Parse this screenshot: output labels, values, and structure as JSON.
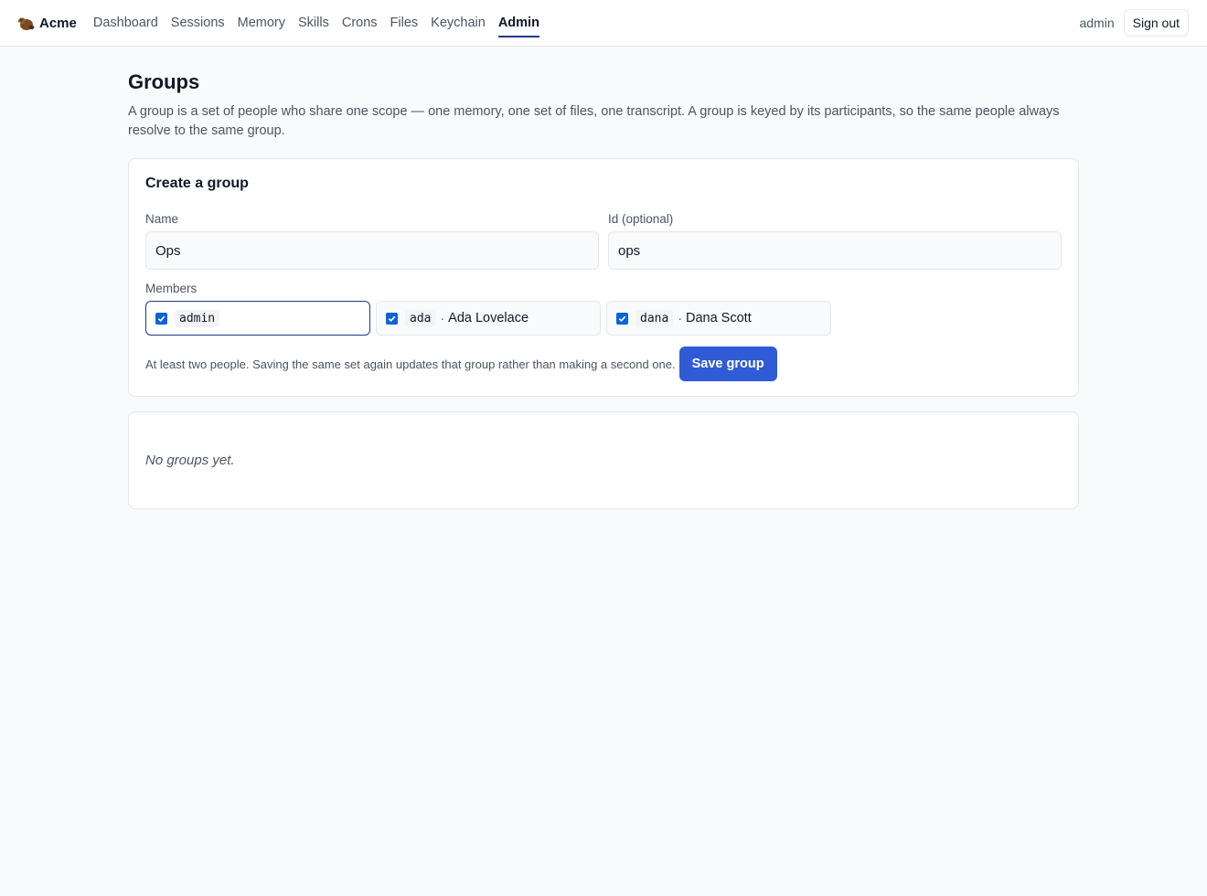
{
  "header": {
    "brand": "Acme",
    "nav": [
      "Dashboard",
      "Sessions",
      "Memory",
      "Skills",
      "Crons",
      "Files",
      "Keychain",
      "Admin"
    ],
    "active_nav": "Admin",
    "user": "admin",
    "signout_label": "Sign out"
  },
  "page": {
    "title": "Groups",
    "description": "A group is a set of people who share one scope — one memory, one set of files, one transcript. A group is keyed by its participants, so the same people always resolve to the same group."
  },
  "create_form": {
    "title": "Create a group",
    "name_label": "Name",
    "name_value": "Ops",
    "id_label": "Id (optional)",
    "id_value": "ops",
    "members_label": "Members",
    "members": [
      {
        "handle": "admin",
        "name": "",
        "checked": true
      },
      {
        "handle": "ada",
        "name": "Ada Lovelace",
        "checked": true
      },
      {
        "handle": "dana",
        "name": "Dana Scott",
        "checked": true
      }
    ],
    "hint": "At least two people. Saving the same set again updates that group rather than making a second one.",
    "save_label": "Save group"
  },
  "groups": {
    "empty_text": "No groups yet."
  },
  "colors": {
    "accent": "#2f5bd6",
    "nav_active_underline": "#1e3a8a",
    "checkbox": "#0b63d9"
  }
}
